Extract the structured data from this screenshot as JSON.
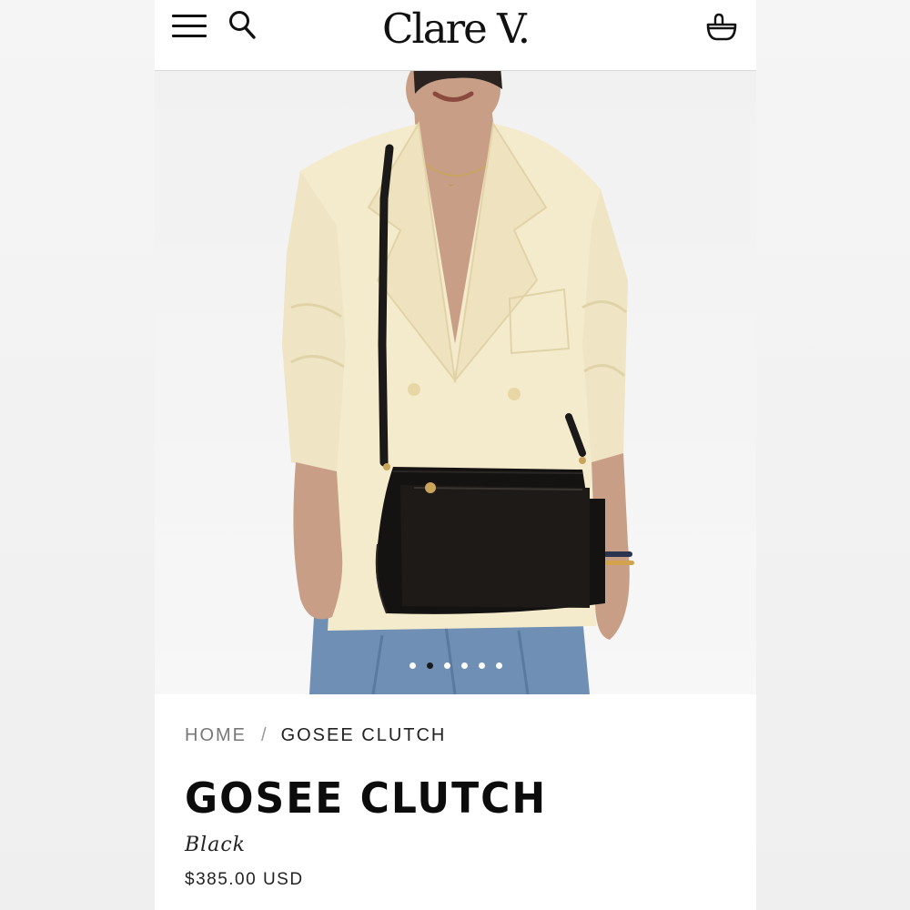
{
  "header": {
    "logo": "Clare V.",
    "menu_icon": "hamburger-menu-icon",
    "search_icon": "search-icon",
    "cart_icon": "shopping-basket-icon"
  },
  "gallery": {
    "image_description": "product-photo",
    "slide_count": 6,
    "active_slide": 1
  },
  "breadcrumb": {
    "home": "HOME",
    "separator": "/",
    "current": "GOSEE CLUTCH"
  },
  "product": {
    "title": "GOSEE CLUTCH",
    "color": "Black",
    "price": "$385.00 USD"
  },
  "colors": {
    "brand_text": "#111111",
    "background": "#ffffff",
    "page_bg": "#f3f3f3"
  }
}
